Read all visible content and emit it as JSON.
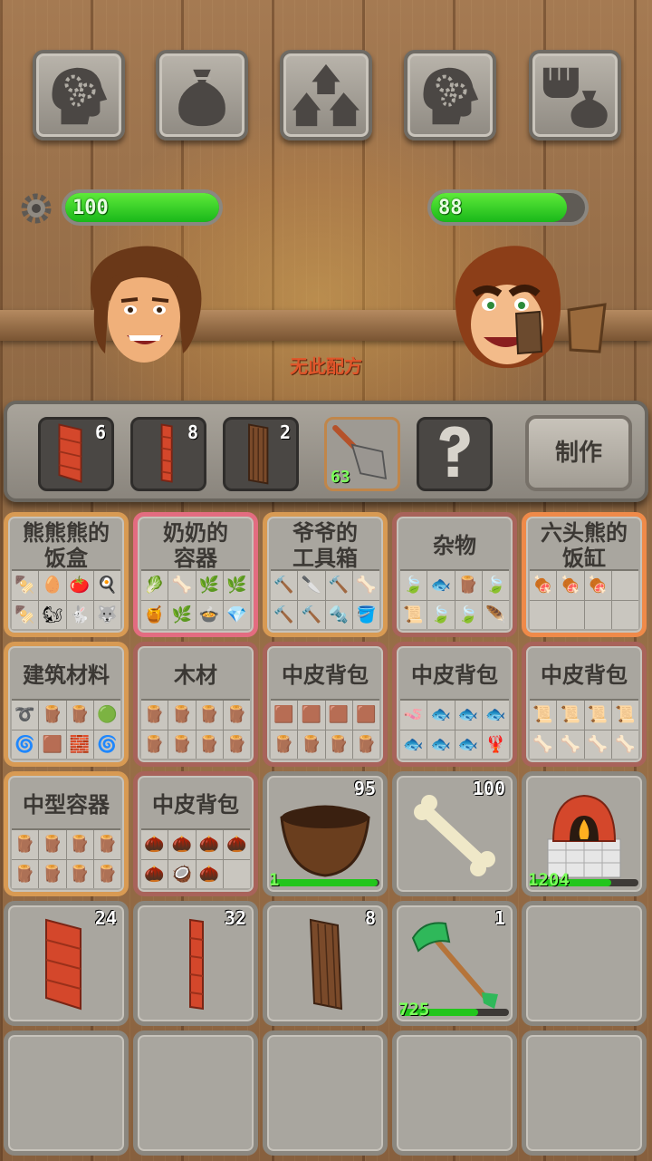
{
  "top_buttons": [
    {
      "name": "skills-head-gears-icon"
    },
    {
      "name": "inventory-sack-icon"
    },
    {
      "name": "village-huts-icon"
    },
    {
      "name": "tech-head-gears-icon"
    },
    {
      "name": "fist-sack-trade-icon"
    }
  ],
  "player": {
    "health_text": "100",
    "health_fill": 1.0
  },
  "opponent": {
    "health_text": "88",
    "health_fill": 0.88
  },
  "recipe_status": "无此配方",
  "craft": {
    "slots": [
      {
        "icon": "red-brick-panel-icon",
        "count": "6"
      },
      {
        "icon": "red-brick-pillar-icon",
        "count": "8"
      },
      {
        "icon": "wooden-door-icon",
        "count": "2"
      },
      {
        "icon": "trowel-icon",
        "count": "",
        "durability": "63"
      },
      {
        "icon": "question-mark-icon",
        "count": ""
      }
    ],
    "make_label": "制作"
  },
  "containers": [
    {
      "title": "熊熊熊的\n饭盒",
      "icons": [
        "🍢",
        "🥚",
        "🍅",
        "🍳",
        "🍢",
        "🐿",
        "🐇",
        "🐺"
      ]
    },
    {
      "title": "奶奶的\n容器",
      "icons": [
        "🥬",
        "🦴",
        "🌿",
        "🌿",
        "🍯",
        "🌿",
        "🍲",
        "💎"
      ]
    },
    {
      "title": "爷爷的\n工具箱",
      "icons": [
        "🔨",
        "🔪",
        "🔨",
        "🦴",
        "🔨",
        "🔨",
        "🔩",
        "🪣"
      ]
    },
    {
      "title": "杂物",
      "icons": [
        "🍃",
        "🐟",
        "🪵",
        "🍃",
        "📜",
        "🍃",
        "🍃",
        "🪶"
      ]
    },
    {
      "title": "六头熊的\n饭缸",
      "icons": [
        "🍖",
        "🍖",
        "🍖",
        "",
        "",
        "",
        "",
        ""
      ]
    },
    {
      "title": "建筑材料",
      "icons": [
        "➰",
        "🪵",
        "🪵",
        "🟢",
        "🌀",
        "🟫",
        "🧱",
        "🌀"
      ]
    },
    {
      "title": "木材",
      "icons": [
        "🪵",
        "🪵",
        "🪵",
        "🪵",
        "🪵",
        "🪵",
        "🪵",
        "🪵"
      ]
    },
    {
      "title": "中皮背包",
      "icons": [
        "🟫",
        "🟫",
        "🟫",
        "🟫",
        "🪵",
        "🪵",
        "🪵",
        "🪵"
      ]
    },
    {
      "title": "中皮背包",
      "icons": [
        "🪱",
        "🐟",
        "🐟",
        "🐟",
        "🐟",
        "🐟",
        "🐟",
        "🦞"
      ]
    },
    {
      "title": "中皮背包",
      "icons": [
        "📜",
        "📜",
        "📜",
        "📜",
        "🦴",
        "🦴",
        "🦴",
        "🦴"
      ]
    },
    {
      "title": "中型容器",
      "icons": [
        "🪵",
        "🪵",
        "🪵",
        "🪵",
        "🪵",
        "🪵",
        "🪵",
        "🪵"
      ]
    },
    {
      "title": "中皮背包",
      "icons": [
        "🌰",
        "🌰",
        "🌰",
        "🌰",
        "🌰",
        "🥥",
        "🌰",
        ""
      ]
    }
  ],
  "items": [
    {
      "name": "coconut-shell-bowl",
      "qty": "95",
      "durability": "1",
      "dur_fill": 0.98
    },
    {
      "name": "bone",
      "qty": "100"
    },
    {
      "name": "brick-oven",
      "qty": "",
      "durability": "1204",
      "dur_fill": 0.75
    },
    {
      "name": "red-brick-panel",
      "qty": "24"
    },
    {
      "name": "red-brick-pillar",
      "qty": "32"
    },
    {
      "name": "wooden-door",
      "qty": "8"
    },
    {
      "name": "jade-axe",
      "qty": "1",
      "durability": "725",
      "dur_fill": 0.72
    }
  ]
}
